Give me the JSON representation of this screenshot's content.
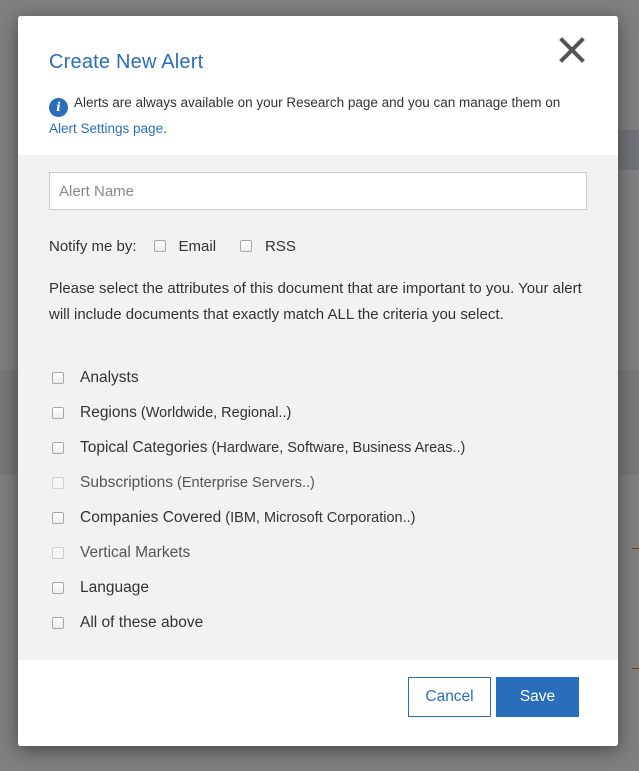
{
  "modal": {
    "title": "Create New Alert",
    "info_text": "Alerts are always available on your Research page and you can manage them on ",
    "info_link": "Alert Settings page",
    "info_suffix": ".",
    "alert_name_placeholder": "Alert Name",
    "notify_label": "Notify me by:",
    "notify_options": [
      "Email",
      "RSS"
    ],
    "description": "Please select the attributes of this document that are important to you. Your alert will include documents that exactly match ALL the criteria you select.",
    "attributes": [
      {
        "label": "Analysts",
        "hint": "",
        "enabled": true
      },
      {
        "label": "Regions",
        "hint": "(Worldwide, Regional..)",
        "enabled": true
      },
      {
        "label": "Topical Categories",
        "hint": "(Hardware, Software, Business Areas..)",
        "enabled": true
      },
      {
        "label": "Subscriptions",
        "hint": "(Enterprise Servers..)",
        "enabled": false
      },
      {
        "label": "Companies Covered",
        "hint": "(IBM, Microsoft Corporation..)",
        "enabled": true
      },
      {
        "label": "Vertical Markets",
        "hint": "",
        "enabled": false
      },
      {
        "label": "Language",
        "hint": "",
        "enabled": true
      },
      {
        "label": "All of these above",
        "hint": "",
        "enabled": true
      }
    ],
    "cancel_label": "Cancel",
    "save_label": "Save"
  },
  "colors": {
    "accent": "#2a6ebb",
    "overlay": "#000000",
    "body_bg": "#f2f2f2"
  },
  "icons": {
    "info": "info-icon",
    "close": "close-icon"
  },
  "info_icon_glyph": "i"
}
